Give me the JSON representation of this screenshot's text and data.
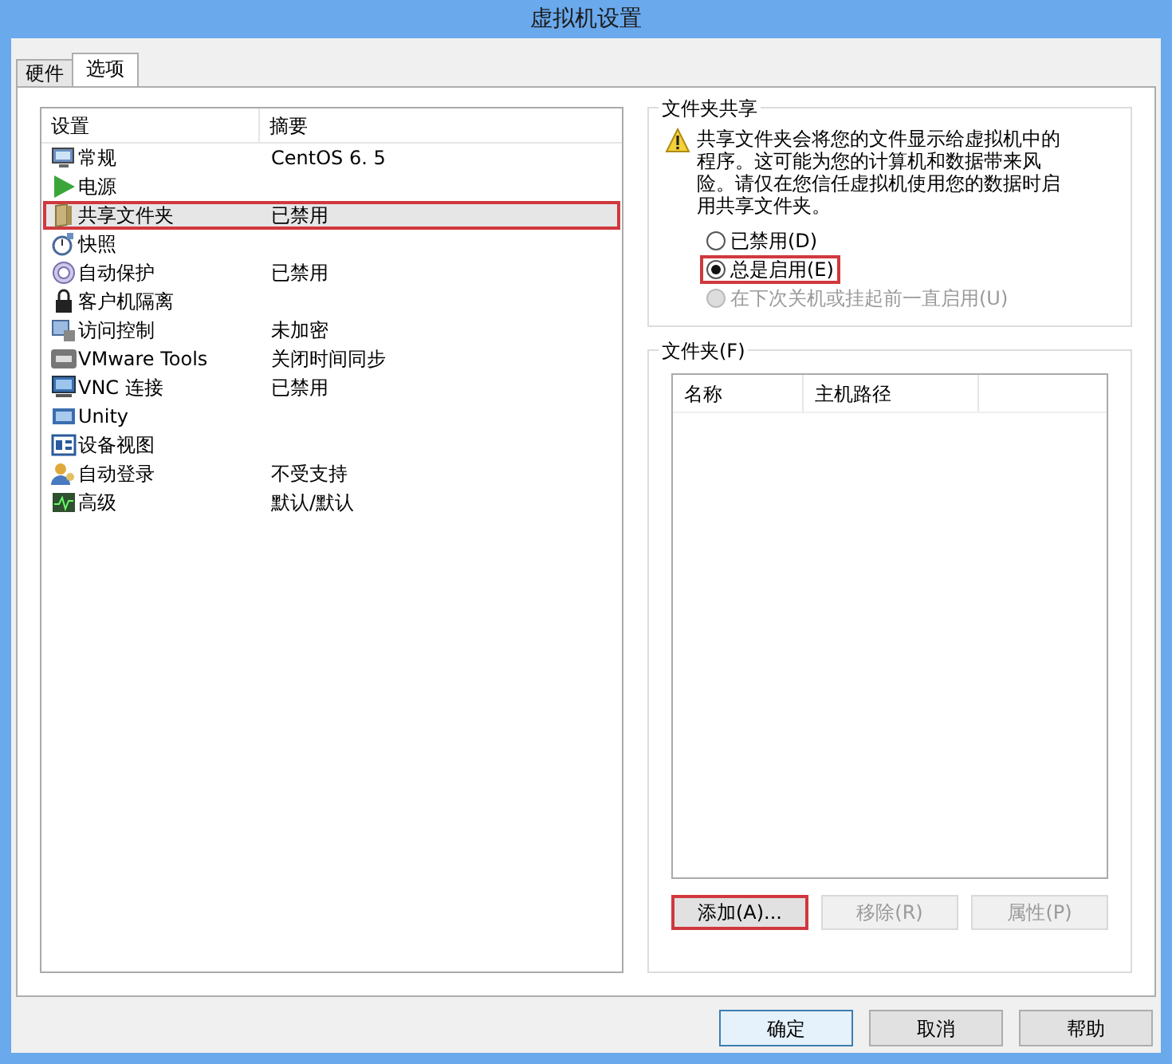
{
  "window": {
    "title": "虚拟机设置"
  },
  "tabs": [
    {
      "label": "硬件",
      "selected": false
    },
    {
      "label": "选项",
      "selected": true
    }
  ],
  "settings_list": {
    "columns": [
      "设置",
      "摘要"
    ],
    "rows": [
      {
        "name": "常规",
        "summary": "CentOS 6. 5",
        "selected": false,
        "annotated": false
      },
      {
        "name": "电源",
        "summary": "",
        "selected": false,
        "annotated": false
      },
      {
        "name": "共享文件夹",
        "summary": "已禁用",
        "selected": true,
        "annotated": true
      },
      {
        "name": "快照",
        "summary": "",
        "selected": false,
        "annotated": false
      },
      {
        "name": "自动保护",
        "summary": "已禁用",
        "selected": false,
        "annotated": false
      },
      {
        "name": "客户机隔离",
        "summary": "",
        "selected": false,
        "annotated": false
      },
      {
        "name": "访问控制",
        "summary": "未加密",
        "selected": false,
        "annotated": false
      },
      {
        "name": "VMware Tools",
        "summary": "关闭时间同步",
        "selected": false,
        "annotated": false
      },
      {
        "name": "VNC 连接",
        "summary": "已禁用",
        "selected": false,
        "annotated": false
      },
      {
        "name": "Unity",
        "summary": "",
        "selected": false,
        "annotated": false
      },
      {
        "name": "设备视图",
        "summary": "",
        "selected": false,
        "annotated": false
      },
      {
        "name": "自动登录",
        "summary": "不受支持",
        "selected": false,
        "annotated": false
      },
      {
        "name": "高级",
        "summary": "默认/默认",
        "selected": false,
        "annotated": false
      }
    ]
  },
  "folder_sharing": {
    "title": "文件夹共享",
    "warning": "共享文件夹会将您的文件显示给虚拟机中的程序。这可能为您的计算机和数据带来风险。请仅在您信任虚拟机使用您的数据时启用共享文件夹。",
    "options": [
      {
        "label": "已禁用(D)",
        "selected": false,
        "disabled": false,
        "annotated": false
      },
      {
        "label": "总是启用(E)",
        "selected": true,
        "disabled": false,
        "annotated": true
      },
      {
        "label": "在下次关机或挂起前一直启用(U)",
        "selected": false,
        "disabled": true,
        "annotated": false
      }
    ]
  },
  "folders": {
    "title": "文件夹(F)",
    "columns": [
      "名称",
      "主机路径"
    ],
    "buttons": [
      {
        "label": "添加(A)...",
        "disabled": false,
        "annotated": true
      },
      {
        "label": "移除(R)",
        "disabled": true,
        "annotated": false
      },
      {
        "label": "属性(P)",
        "disabled": true,
        "annotated": false
      }
    ]
  },
  "footer_buttons": [
    {
      "label": "确定",
      "default": true
    },
    {
      "label": "取消",
      "default": false
    },
    {
      "label": "帮助",
      "default": false
    }
  ]
}
